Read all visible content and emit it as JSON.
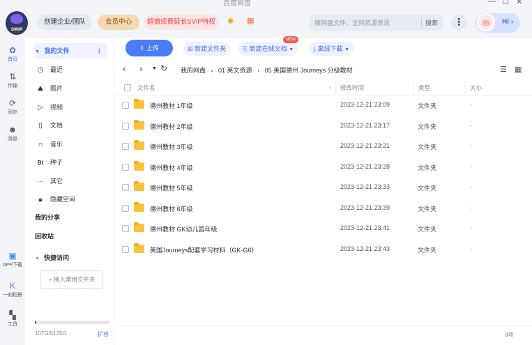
{
  "window": {
    "title": "百度网盘"
  },
  "header": {
    "logo_badge": "SWIP",
    "team_label": "创建企业/团队",
    "vip_label": "会员中心",
    "promo_label": "超值续费延长SVIP特权",
    "search_placeholder": "搜网盘文件、全网资源资讯",
    "search_button": "搜索",
    "greeting": "Hi",
    "accent_color": "#4a6cf7"
  },
  "rail": {
    "items": [
      {
        "label": "首页",
        "icon": "home-icon"
      },
      {
        "label": "传输",
        "icon": "transfer-icon"
      },
      {
        "label": "同步",
        "icon": "sync-icon"
      },
      {
        "label": "消息",
        "icon": "message-icon"
      },
      {
        "label": "APP下载",
        "icon": "app-download-icon"
      },
      {
        "label": "一刻相册",
        "icon": "album-icon"
      },
      {
        "label": "工具",
        "icon": "tools-icon"
      }
    ]
  },
  "sidebar": {
    "my_files": "我的文件",
    "items": [
      {
        "label": "最近",
        "icon": "clock-icon"
      },
      {
        "label": "图片",
        "icon": "image-icon"
      },
      {
        "label": "视频",
        "icon": "video-icon"
      },
      {
        "label": "文档",
        "icon": "document-icon"
      },
      {
        "label": "音乐",
        "icon": "music-icon"
      },
      {
        "label": "种子",
        "icon": "bt-icon"
      },
      {
        "label": "其它",
        "icon": "more-icon"
      },
      {
        "label": "隐藏空间",
        "icon": "lock-icon"
      }
    ],
    "my_share": "我的分享",
    "recycle": "回收站",
    "quick_access": "快捷访问",
    "add_folder": "+ 拖入常用文件夹",
    "storage": "107G/5125G",
    "storage_fraction": 0.02,
    "expand": "扩容"
  },
  "toolbar": {
    "upload": "上传",
    "new_folder": "新建文件夹",
    "new_online_doc": "新建在线文档",
    "new_badge": "NEW",
    "offline_download": "离线下载"
  },
  "breadcrumb": {
    "root": "我的网盘",
    "level1": "01 英文资源",
    "level2": "05 美国德州 Journeys 分级教材"
  },
  "table": {
    "headers": {
      "name": "文件名",
      "mtime": "修改时间",
      "type": "类型",
      "size": "大小"
    },
    "rows": [
      {
        "name": "德州教材 1年级",
        "time": "2023-12-21 23:09",
        "type": "文件夹",
        "size": "-"
      },
      {
        "name": "德州教材 2年级",
        "time": "2023-12-21 23:17",
        "type": "文件夹",
        "size": "-"
      },
      {
        "name": "德州教材 3年级",
        "time": "2023-12-21 23:21",
        "type": "文件夹",
        "size": "-"
      },
      {
        "name": "德州教材 4年级",
        "time": "2023-12-21 23:28",
        "type": "文件夹",
        "size": "-"
      },
      {
        "name": "德州教材 5年级",
        "time": "2023-12-21 23:33",
        "type": "文件夹",
        "size": "-"
      },
      {
        "name": "德州教材 6年级",
        "time": "2023-12-21 23:39",
        "type": "文件夹",
        "size": "-"
      },
      {
        "name": "德州教材 GK幼儿园年级",
        "time": "2023-12-21 23:41",
        "type": "文件夹",
        "size": "-"
      },
      {
        "name": "美国Journeys配套学习材料（GK-G6）",
        "time": "2023-12-21 23:43",
        "type": "文件夹",
        "size": "-"
      }
    ],
    "count": "8项"
  }
}
